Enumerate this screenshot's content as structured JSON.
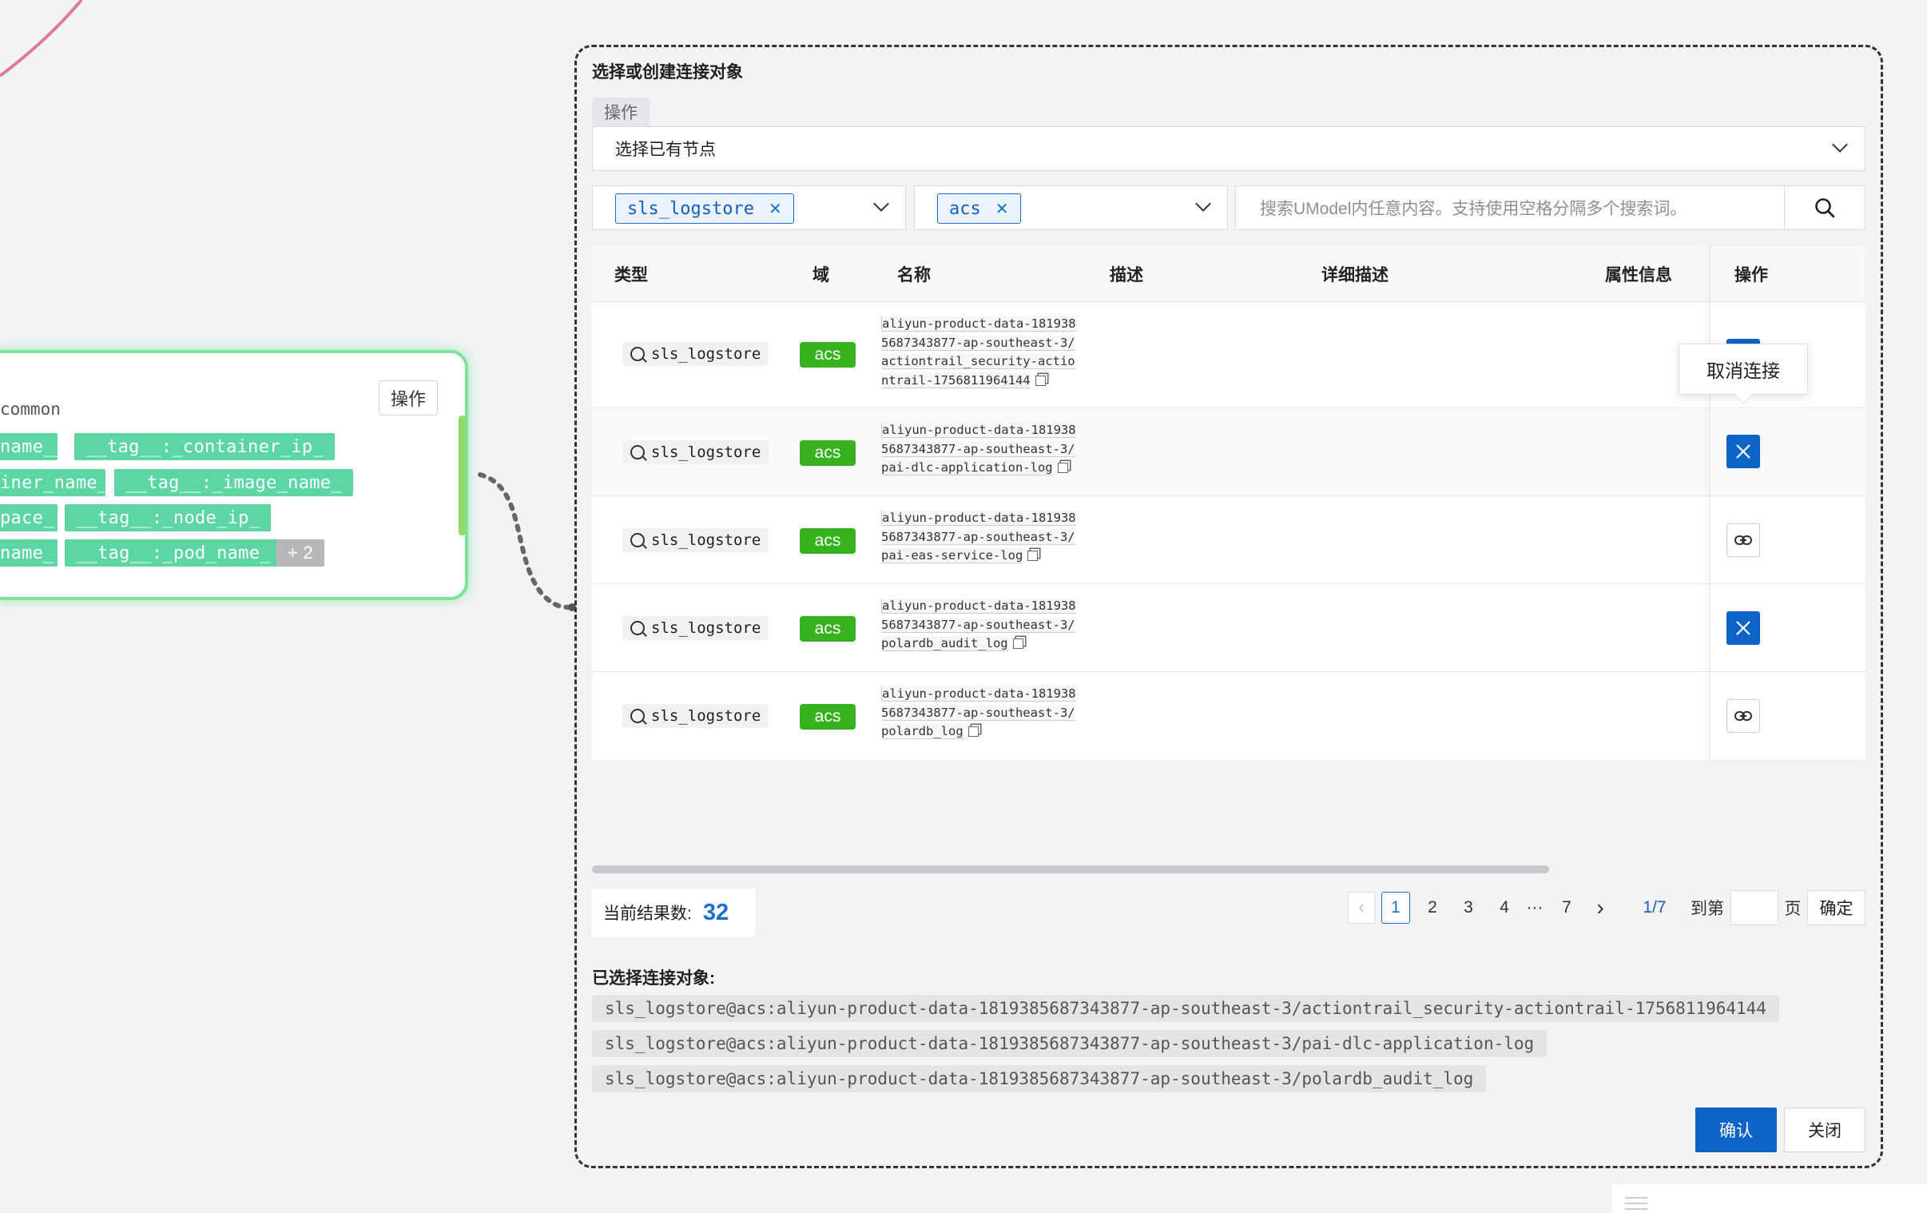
{
  "node": {
    "op_label": "操作",
    "group": "common",
    "tags": [
      "name__",
      "__tag__:_container_ip_",
      "iner_name_",
      "__tag__:_image_name_",
      "pace_",
      "__tag__:_node_ip_",
      "name_",
      "__tag__:_pod_name_"
    ],
    "more": "+ 2"
  },
  "panel": {
    "title": "选择或创建连接对象",
    "op_chip": "操作",
    "select_value": "选择已有节点",
    "filter1_tag": "sls_logstore",
    "filter2_tag": "acs",
    "search_placeholder": "搜索UModel内任意内容。支持使用空格分隔多个搜索词。"
  },
  "table": {
    "headers": [
      "类型",
      "域",
      "名称",
      "描述",
      "详细描述",
      "属性信息",
      "操作"
    ],
    "rows": [
      {
        "type": "sls_logstore",
        "domain": "acs",
        "name": "aliyun-product-data-1819385687343877-ap-southeast-3/actiontrail_security-actiontrail-1756811964144",
        "action": "disconnect"
      },
      {
        "type": "sls_logstore",
        "domain": "acs",
        "name": "aliyun-product-data-1819385687343877-ap-southeast-3/pai-dlc-application-log",
        "action": "disconnect"
      },
      {
        "type": "sls_logstore",
        "domain": "acs",
        "name": "aliyun-product-data-1819385687343877-ap-southeast-3/pai-eas-service-log",
        "action": "connect"
      },
      {
        "type": "sls_logstore",
        "domain": "acs",
        "name": "aliyun-product-data-1819385687343877-ap-southeast-3/polardb_audit_log",
        "action": "disconnect"
      },
      {
        "type": "sls_logstore",
        "domain": "acs",
        "name": "aliyun-product-data-1819385687343877-ap-southeast-3/polardb_log",
        "action": "connect"
      }
    ],
    "tooltip": "取消连接"
  },
  "footer": {
    "count_label": "当前结果数:",
    "count_value": "32",
    "pages": [
      "1",
      "2",
      "3",
      "4",
      "···",
      "7"
    ],
    "page_indicator": "1/7",
    "goto_label": "到第",
    "page_unit": "页",
    "go_button": "确定"
  },
  "selected": {
    "title": "已选择连接对象:",
    "items": [
      "sls_logstore@acs:aliyun-product-data-1819385687343877-ap-southeast-3/actiontrail_security-actiontrail-1756811964144",
      "sls_logstore@acs:aliyun-product-data-1819385687343877-ap-southeast-3/pai-dlc-application-log",
      "sls_logstore@acs:aliyun-product-data-1819385687343877-ap-southeast-3/polardb_audit_log"
    ]
  },
  "buttons": {
    "confirm": "确认",
    "close": "关闭"
  },
  "colors": {
    "accent": "#0e63c7",
    "domain_green": "#36b21f",
    "tag_green": "#5cd6a3",
    "node_border": "#7de39a",
    "edge_pink": "#e07a9a"
  }
}
